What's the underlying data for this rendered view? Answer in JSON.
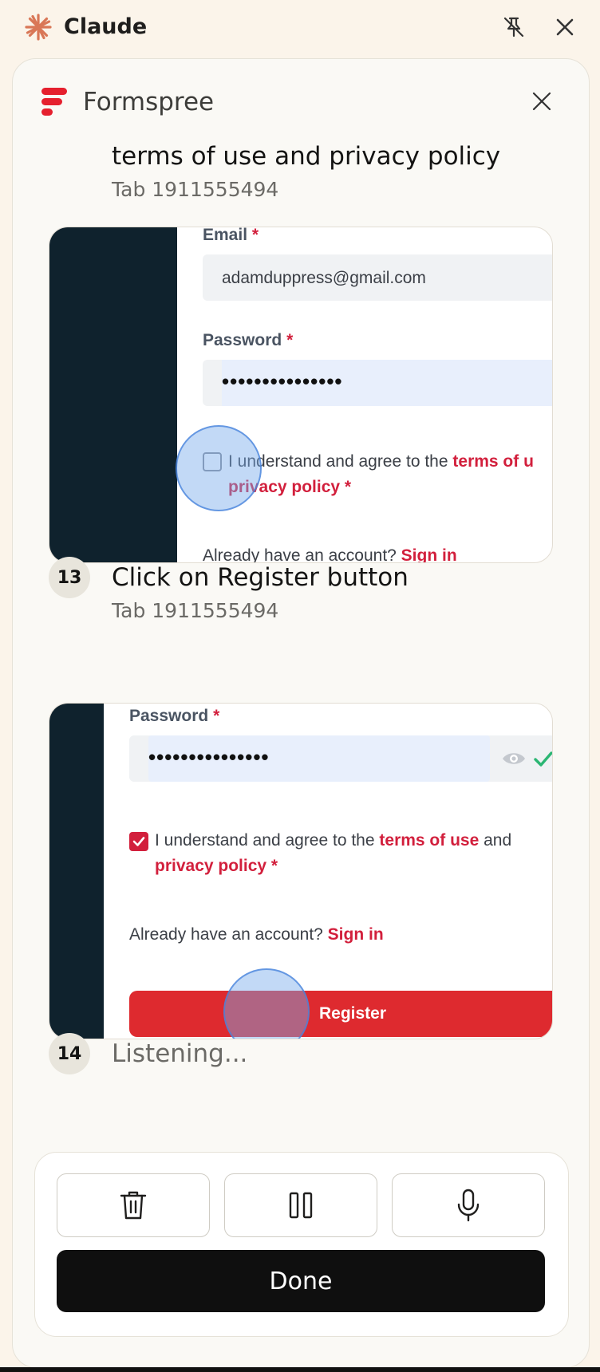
{
  "app": {
    "title": "Claude",
    "accent": "#d97757"
  },
  "panel": {
    "title": "Formspree",
    "brand_color": "#e5202e"
  },
  "steps": [
    {
      "title": "terms of use and privacy policy",
      "tab": "Tab 1911555494",
      "screenshot": {
        "email_label": "Email",
        "required_mark": "*",
        "email_value": "adamduppress@gmail.com",
        "password_label": "Password",
        "password_dots": "•••••••••••••••",
        "agree_text": "I understand and agree to the ",
        "terms_link": "terms of u",
        "privacy_link": "privacy policy",
        "account_text": "Already have an account? ",
        "signin_link": "Sign in",
        "checkbox_checked": false
      }
    },
    {
      "number": "13",
      "title": "Click on Register button",
      "tab": "Tab 1911555494",
      "screenshot": {
        "password_label": "Password",
        "required_mark": "*",
        "password_dots": "•••••••••••••••",
        "agree_text": "I understand and agree to the ",
        "terms_link": "terms of use",
        "and_text": " and",
        "privacy_link": "privacy policy",
        "account_text": "Already have an account? ",
        "signin_link": "Sign in",
        "register_label": "Register",
        "checkbox_checked": true
      }
    },
    {
      "number": "14",
      "title": "Listening..."
    }
  ],
  "controls": {
    "delete_icon": "trash-icon",
    "pause_icon": "pause-icon",
    "mic_icon": "microphone-icon",
    "done_label": "Done"
  }
}
